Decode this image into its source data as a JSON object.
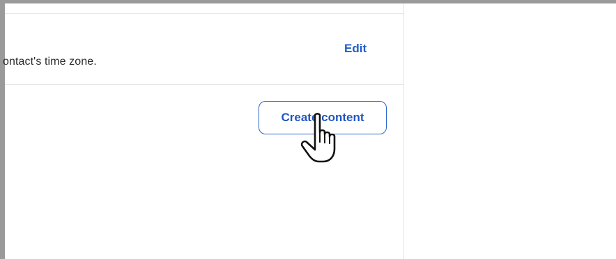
{
  "section": {
    "description_visible": "ontact's time zone.",
    "edit_label": "Edit"
  },
  "actions": {
    "create_content_label": "Create content"
  },
  "icons": {
    "cursor": "hand-pointer-icon"
  },
  "colors": {
    "link_blue": "#1f5fc7",
    "button_border": "#2a64c8",
    "divider": "#e6e6e6",
    "frame": "#9a9a9a"
  }
}
